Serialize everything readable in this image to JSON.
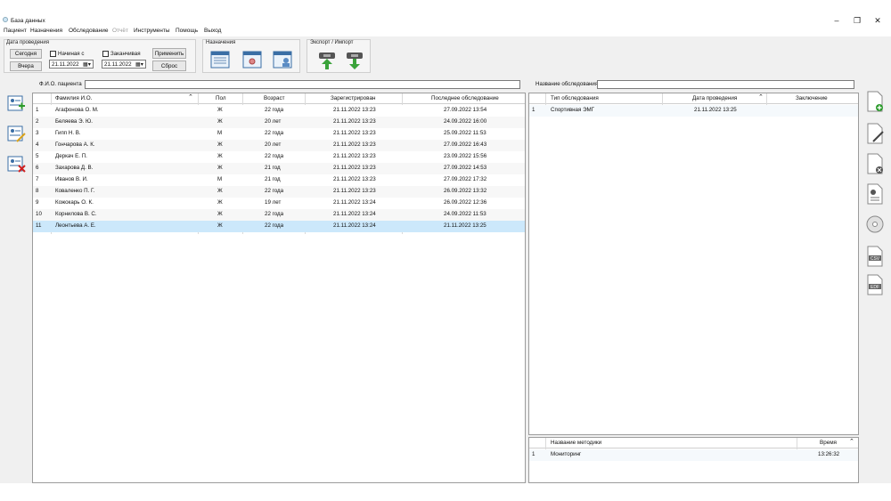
{
  "window": {
    "title": "База данных",
    "minimize": "–",
    "maximize": "❐",
    "close": "✕"
  },
  "menu": [
    "Пациент",
    "Назначения",
    "Обследование",
    "Отчёт",
    "Инструменты",
    "Помощь",
    "Выход"
  ],
  "date_filter": {
    "group_label": "Дата проведения",
    "today_label": "Сегодня",
    "yesterday_label": "Вчера",
    "start_label": "Начиная с",
    "end_label": "Заканчивая",
    "start_date": "21.11.2022",
    "end_date": "21.11.2022",
    "apply_label": "Применить",
    "reset_label": "Сброс"
  },
  "assignments": {
    "group_label": "Назначения"
  },
  "export_import": {
    "group_label": "Экспорт / Импорт"
  },
  "patient_search": {
    "label": "Ф.И.О. пациента",
    "value": ""
  },
  "exam_search": {
    "label": "Название обследования",
    "value": ""
  },
  "patients_table": {
    "headers": {
      "num": "",
      "name": "Фамилия И.О.",
      "sex": "Пол",
      "age": "Возраст",
      "registered": "Зарегистрирован",
      "last_exam": "Последнее обследование"
    },
    "rows": [
      {
        "num": "1",
        "name": "Агафонова О. М.",
        "sex": "Ж",
        "age": "22 года",
        "registered": "21.11.2022 13:23",
        "last_exam": "27.09.2022 13:54"
      },
      {
        "num": "2",
        "name": "Беляева Э. Ю.",
        "sex": "Ж",
        "age": "20 лет",
        "registered": "21.11.2022 13:23",
        "last_exam": "24.09.2022 16:00"
      },
      {
        "num": "3",
        "name": "Гипп Н. В.",
        "sex": "М",
        "age": "22 года",
        "registered": "21.11.2022 13:23",
        "last_exam": "25.09.2022 11:53"
      },
      {
        "num": "4",
        "name": "Гончарова А. К.",
        "sex": "Ж",
        "age": "20 лет",
        "registered": "21.11.2022 13:23",
        "last_exam": "27.09.2022 16:43"
      },
      {
        "num": "5",
        "name": "Деркач Е. П.",
        "sex": "Ж",
        "age": "22 года",
        "registered": "21.11.2022 13:23",
        "last_exam": "23.09.2022 15:56"
      },
      {
        "num": "6",
        "name": "Захарова Д. В.",
        "sex": "Ж",
        "age": "21 год",
        "registered": "21.11.2022 13:23",
        "last_exam": "27.09.2022 14:53"
      },
      {
        "num": "7",
        "name": "Иванов В. И.",
        "sex": "М",
        "age": "21 год",
        "registered": "21.11.2022 13:23",
        "last_exam": "27.09.2022 17:32"
      },
      {
        "num": "8",
        "name": "Коваленко П. Г.",
        "sex": "Ж",
        "age": "22 года",
        "registered": "21.11.2022 13:23",
        "last_exam": "26.09.2022 13:32"
      },
      {
        "num": "9",
        "name": "Кожокарь О. К.",
        "sex": "Ж",
        "age": "19 лет",
        "registered": "21.11.2022 13:24",
        "last_exam": "26.09.2022 12:36"
      },
      {
        "num": "10",
        "name": "Корнилова В. С.",
        "sex": "Ж",
        "age": "22 года",
        "registered": "21.11.2022 13:24",
        "last_exam": "24.09.2022 11:53"
      },
      {
        "num": "11",
        "name": "Леонтьева А. Е.",
        "sex": "Ж",
        "age": "22 года",
        "registered": "21.11.2022 13:24",
        "last_exam": "21.11.2022 13:25"
      }
    ]
  },
  "exams_table": {
    "headers": {
      "type": "Тип обследования",
      "date": "Дата проведения",
      "conclusion": "Заключение"
    },
    "rows": [
      {
        "num": "1",
        "type": "Спортивная ЭМГ",
        "date": "21.11.2022 13:25",
        "conclusion": ""
      }
    ]
  },
  "methods_table": {
    "headers": {
      "name": "Название методики",
      "time": "Время"
    },
    "rows": [
      {
        "num": "1",
        "name": "Мониторинг",
        "time": "13:26:32"
      }
    ]
  },
  "right_icons": [
    "add-document-icon",
    "edit-document-icon",
    "delete-document-icon",
    "report-icon",
    "disc-icon",
    "csv-export-icon",
    "edf-export-icon"
  ],
  "right_icon_text": {
    "csv": "CSV",
    "edf": "EDF"
  }
}
